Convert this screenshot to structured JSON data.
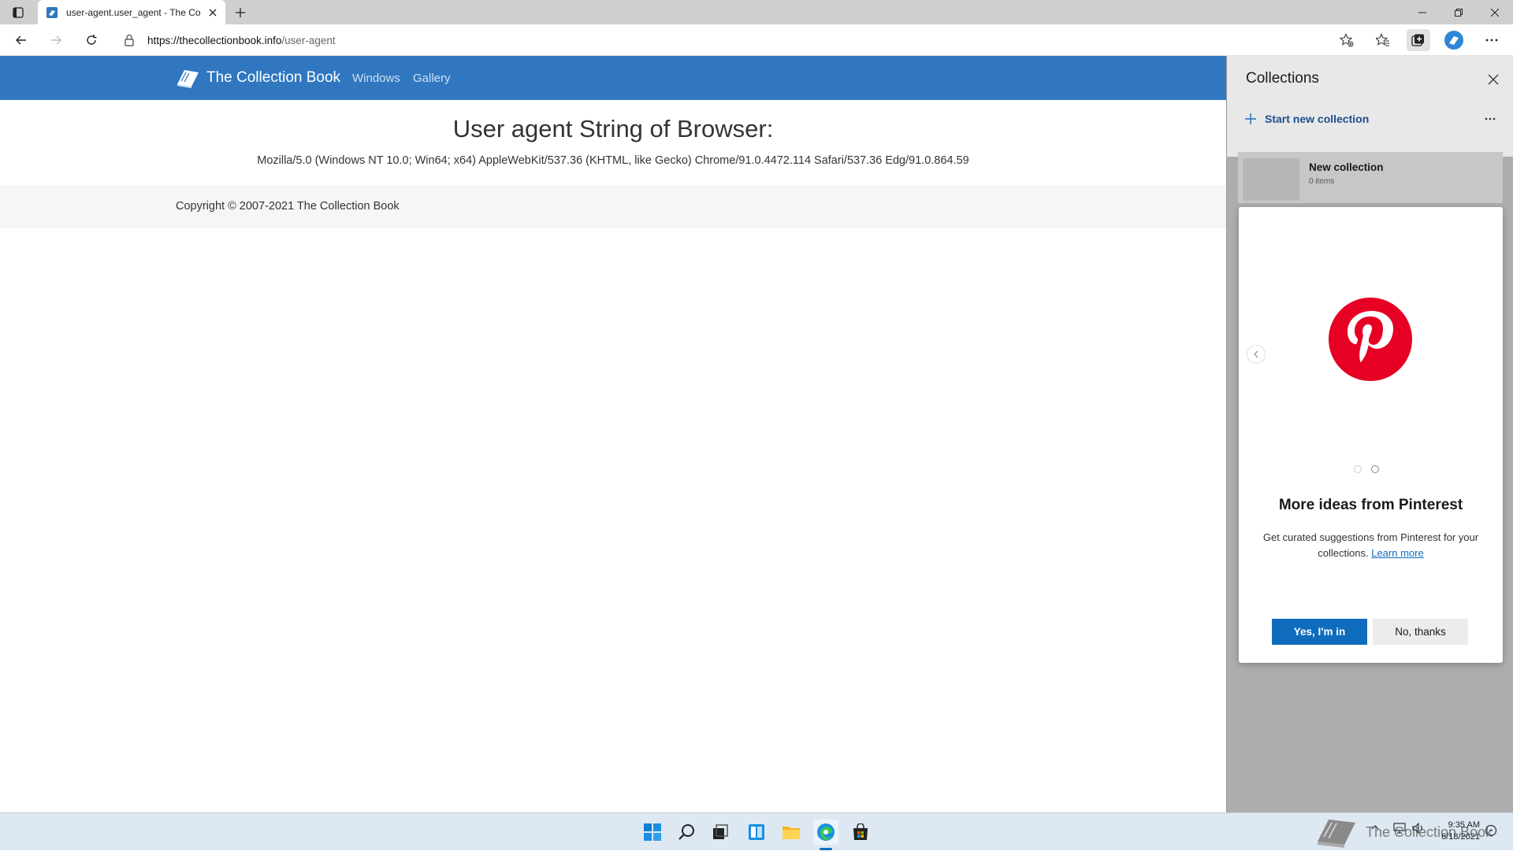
{
  "browser": {
    "tab_title": "user-agent.user_agent - The Collection Book",
    "url_scheme_host": "https://thecollectionbook.info",
    "url_path": "/user-agent"
  },
  "site": {
    "brand": "The Collection Book",
    "nav": [
      "Windows",
      "Gallery"
    ],
    "heading": "User agent String of Browser:",
    "user_agent": "Mozilla/5.0 (Windows NT 10.0; Win64; x64) AppleWebKit/537.36 (KHTML, like Gecko) Chrome/91.0.4472.114 Safari/537.36 Edg/91.0.864.59",
    "copyright": "Copyright © 2007-2021 The Collection Book"
  },
  "collections": {
    "title": "Collections",
    "start_new": "Start new collection",
    "collection_name": "New collection",
    "collection_count": "0 items",
    "promo_title": "More ideas from Pinterest",
    "promo_body": "Get curated suggestions from Pinterest for your collections.",
    "learn_more": "Learn more",
    "yes_label": "Yes, I'm in",
    "no_label": "No, thanks"
  },
  "taskbar": {
    "watermark_text": "The Collection Book",
    "time": "9:35 AM",
    "date": "6/18/2021"
  },
  "colors": {
    "site_nav": "#3077c0",
    "accent": "#0f6cbd",
    "pinterest": "#e60023"
  }
}
